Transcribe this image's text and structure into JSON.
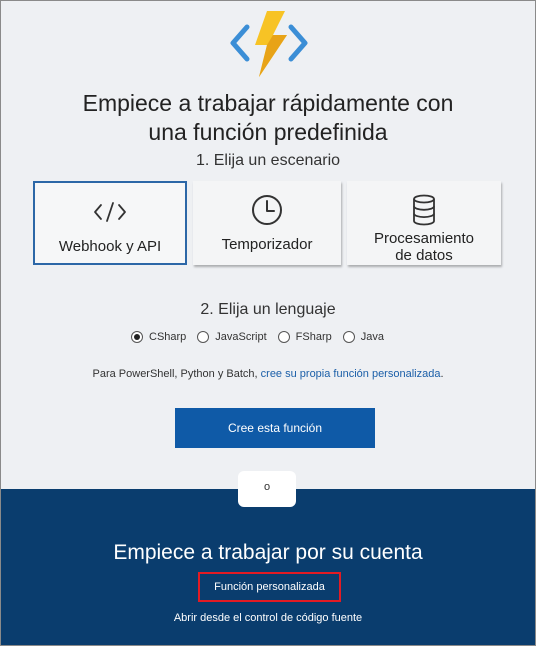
{
  "colors": {
    "top_background": "#eef0f3",
    "bottom_background": "#0a3d6e",
    "primary_button": "#0f5aa7",
    "link": "#1b5fa8",
    "highlight_box": "#e31b23",
    "selected_card_border": "#2c67a7",
    "logo_bolt": "#f7c325",
    "logo_brackets": "#3b8ed6"
  },
  "logo": {
    "icon": "azure-functions-logo-icon"
  },
  "heading": {
    "line1": "Empiece a trabajar rápidamente con",
    "line2": "una función predefinida"
  },
  "scenario": {
    "step_label": "1. Elija un escenario",
    "cards": [
      {
        "label": "Webhook y API",
        "icon": "code-brackets-icon",
        "selected": true
      },
      {
        "label": "Temporizador",
        "icon": "clock-icon",
        "selected": false
      },
      {
        "label": "Procesamiento de datos",
        "label_line1": "Procesamiento",
        "label_line2": "de datos",
        "icon": "database-icon",
        "selected": false
      }
    ]
  },
  "language": {
    "step_label": "2. Elija un lenguaje",
    "options": [
      {
        "label": "CSharp",
        "checked": true
      },
      {
        "label": "JavaScript",
        "checked": false
      },
      {
        "label": "FSharp",
        "checked": false
      },
      {
        "label": "Java",
        "checked": false
      }
    ]
  },
  "note": {
    "text": "Para PowerShell, Python y Batch, ",
    "link": "cree su propia función personalizada",
    "suffix": "."
  },
  "create_button": {
    "label": "Cree esta función"
  },
  "divider": {
    "label": "o"
  },
  "own": {
    "title": "Empiece a trabajar por su cuenta",
    "custom_function_link": "Función personalizada",
    "source_control_link": "Abrir desde el control de código fuente"
  }
}
